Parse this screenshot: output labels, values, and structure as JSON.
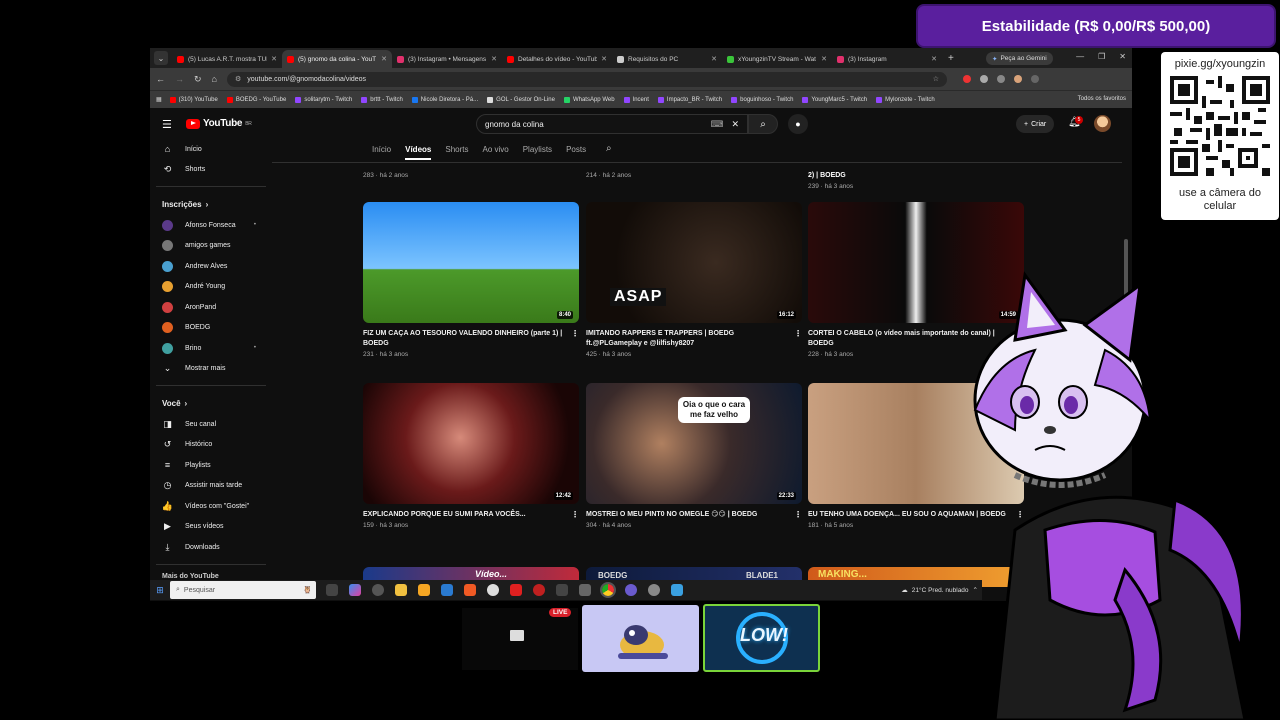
{
  "overlay": {
    "goal_label": "Estabilidade (R$ 0,00/R$ 500,00)",
    "goal_current": 0,
    "goal_target": 500,
    "accent": "#5a1f9e",
    "qr": {
      "url": "pixie.gg/xyoungzin",
      "caption": "use a câmera do celular"
    },
    "live_badge": "LIVE",
    "sticker_text": "LOW!"
  },
  "browser": {
    "tabs": [
      {
        "label": "(5) Lucas A.R.T. mostra TUD",
        "color": "#ff0000"
      },
      {
        "label": "(5) gnomo da colina - YouT",
        "color": "#ff0000",
        "active": true
      },
      {
        "label": "(3) Instagram • Mensagens",
        "color": "#e1306c"
      },
      {
        "label": "Detalhes do vídeo - YouTub",
        "color": "#ff0000"
      },
      {
        "label": "Requisitos do PC",
        "color": "#cccccc"
      },
      {
        "label": "xYoungzinTV Stream - Wat",
        "color": "#3ac53a"
      },
      {
        "label": "(3) Instagram",
        "color": "#e1306c"
      }
    ],
    "gemini_button": "Peça ao Gemini",
    "url": "youtube.com/@gnomodacolina/videos",
    "bookmarks": [
      {
        "label": "(310) YouTube",
        "color": "#ff0000"
      },
      {
        "label": "BOEDG - YouTube",
        "color": "#ff0000"
      },
      {
        "label": "solitarytm - Twitch",
        "color": "#9146ff"
      },
      {
        "label": "brttt - Twitch",
        "color": "#9146ff"
      },
      {
        "label": "Nicole Diretora - Pá...",
        "color": "#1877f2"
      },
      {
        "label": "GOL - Gestor On-Line",
        "color": "#dddddd"
      },
      {
        "label": "WhatsApp Web",
        "color": "#25d366"
      },
      {
        "label": "Incent",
        "color": "#9146ff"
      },
      {
        "label": "Impacto_BR - Twitch",
        "color": "#9146ff"
      },
      {
        "label": "boguinhoso - Twitch",
        "color": "#9146ff"
      },
      {
        "label": "YoungMarc5 - Twitch",
        "color": "#9146ff"
      },
      {
        "label": "Mylonzete - Twitch",
        "color": "#9146ff"
      }
    ],
    "all_bookmarks": "Todos os favoritos"
  },
  "youtube": {
    "logo": "YouTube",
    "logo_region": "BR",
    "search_value": "gnomo da colina",
    "create_label": "Criar",
    "notifications_count": "5",
    "sidebar": {
      "top": [
        {
          "label": "Início",
          "icon": "home-icon",
          "glyph": "⌂"
        },
        {
          "label": "Shorts",
          "icon": "shorts-icon",
          "glyph": "⟲"
        }
      ],
      "subscriptions_heading": "Inscrições",
      "subscriptions": [
        {
          "label": "Afonso Fonseca",
          "color": "#5b3a8a",
          "dot": true
        },
        {
          "label": "amigos games",
          "color": "#777777",
          "dot": false
        },
        {
          "label": "Andrew Alves",
          "color": "#4aa0d0",
          "dot": false
        },
        {
          "label": "André Young",
          "color": "#e8a030",
          "dot": false
        },
        {
          "label": "AronPand",
          "color": "#d04040",
          "dot": false
        },
        {
          "label": "BOEDG",
          "color": "#e06020",
          "dot": false
        },
        {
          "label": "Brino",
          "color": "#40a0a0",
          "dot": true
        }
      ],
      "show_more": "Mostrar mais",
      "you_heading": "Você",
      "you": [
        {
          "label": "Seu canal",
          "icon": "channel-icon",
          "glyph": "◨"
        },
        {
          "label": "Histórico",
          "icon": "history-icon",
          "glyph": "↺"
        },
        {
          "label": "Playlists",
          "icon": "playlists-icon",
          "glyph": "≡"
        },
        {
          "label": "Assistir mais tarde",
          "icon": "clock-icon",
          "glyph": "◷"
        },
        {
          "label": "Vídeos com \"Gostei\"",
          "icon": "like-icon",
          "glyph": "👍"
        },
        {
          "label": "Seus vídeos",
          "icon": "your-videos-icon",
          "glyph": "▶"
        },
        {
          "label": "Downloads",
          "icon": "download-icon",
          "glyph": "⤓"
        }
      ],
      "more_heading": "Mais do YouTube"
    },
    "channel_tabs": [
      "Início",
      "Vídeos",
      "Shorts",
      "Ao vivo",
      "Playlists",
      "Posts"
    ],
    "active_tab": "Vídeos",
    "previous_row": [
      {
        "meta": "283 · há 2 anos"
      },
      {
        "meta": "214 · há 2 anos"
      },
      {
        "title": "2) | BOEDG",
        "meta": "239 · há 3 anos"
      }
    ],
    "videos": [
      {
        "title": "FIZ UM CAÇA AO TESOURO VALENDO DINHEIRO (parte 1) | BOEDG",
        "meta": "231 · há 3 anos",
        "duration": "8:40"
      },
      {
        "title": "IMITANDO RAPPERS E TRAPPERS | BOEDG ft.@PLGameplay e @lilfishy8207",
        "meta": "425 · há 3 anos",
        "duration": "16:12",
        "overlay_text": "ASAP"
      },
      {
        "title": "CORTEI O CABELO (o vídeo mais importante do canal) | BOEDG",
        "meta": "228 · há 3 anos",
        "duration": "14:59"
      },
      {
        "title": "EXPLICANDO PORQUE EU SUMI PARA VOCÊS...",
        "meta": "159 · há 3 anos",
        "duration": "12:42"
      },
      {
        "title": "MOSTREI O MEU PINT0 NO OMEGLE 😏😏 | BOEDG",
        "meta": "304 · há 4 anos",
        "duration": "22:33",
        "overlay_text": "Oia o que o cara me faz velho"
      },
      {
        "title": "EU TENHO UMA DOENÇA... EU SOU O AQUAMAN | BOEDG",
        "meta": "181 · há 5 anos",
        "duration": ""
      }
    ],
    "next_row_labels": [
      "Vídeo...",
      "BOEDG",
      "BLADE1",
      "MAKING..."
    ]
  },
  "taskbar": {
    "search_placeholder": "Pesquisar",
    "weather": "21°C  Pred. nublado"
  }
}
